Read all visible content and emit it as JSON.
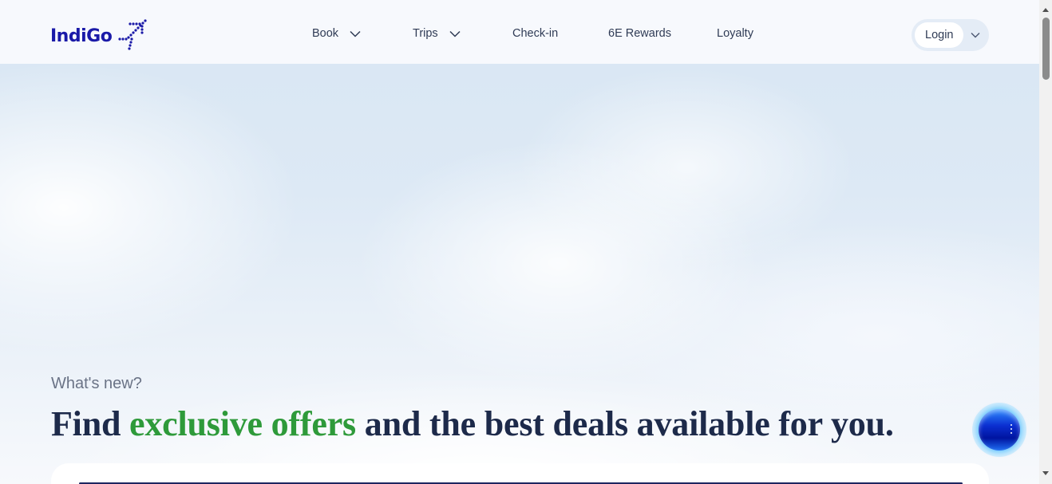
{
  "header": {
    "logo_text": "IndiGo",
    "logo_icon": "plane-dots-icon",
    "nav": [
      {
        "label": "Book",
        "has_dropdown": true
      },
      {
        "label": "Trips",
        "has_dropdown": true
      },
      {
        "label": "Check-in",
        "has_dropdown": false
      },
      {
        "label": "6E Rewards",
        "has_dropdown": false
      },
      {
        "label": "Loyalty",
        "has_dropdown": false
      }
    ],
    "login_label": "Login"
  },
  "hero": {
    "eyebrow": "What's new?",
    "headline_part1": "Find ",
    "headline_highlight": "exclusive offers",
    "headline_part2": " and the best deals available for you."
  },
  "chat": {
    "icon": "assistant-orb-icon"
  },
  "colors": {
    "brand": "#1a1aa8",
    "highlight_green": "#2e9a3a",
    "headline_text": "#1d2a4a"
  }
}
